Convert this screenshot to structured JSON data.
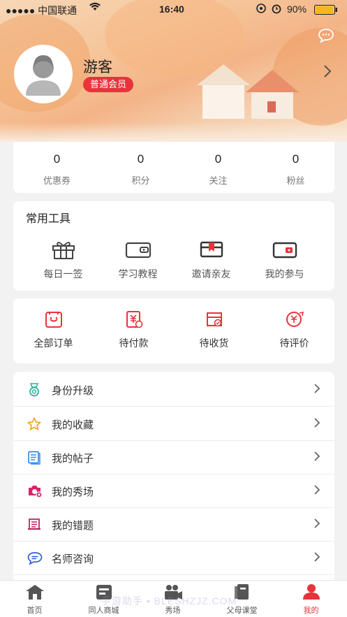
{
  "status_bar": {
    "carrier": "●●●●● 中国联通",
    "time": "16:40",
    "battery": "90%"
  },
  "profile": {
    "username": "游客",
    "membership": "普通会员"
  },
  "stats": [
    {
      "value": "0",
      "label": "优惠券"
    },
    {
      "value": "0",
      "label": "积分"
    },
    {
      "value": "0",
      "label": "关注"
    },
    {
      "value": "0",
      "label": "粉丝"
    }
  ],
  "tools": {
    "title": "常用工具",
    "items": [
      {
        "label": "每日一签",
        "icon": "gift-icon"
      },
      {
        "label": "学习教程",
        "icon": "wallet-icon"
      },
      {
        "label": "邀请亲友",
        "icon": "box-icon"
      },
      {
        "label": "我的参与",
        "icon": "card-icon"
      }
    ]
  },
  "orders": [
    {
      "label": "全部订单",
      "icon": "order-list-icon"
    },
    {
      "label": "待付款",
      "icon": "payment-icon"
    },
    {
      "label": "待收货",
      "icon": "delivery-icon"
    },
    {
      "label": "待评价",
      "icon": "review-icon"
    }
  ],
  "menu": [
    {
      "label": "身份升级",
      "icon": "medal-icon"
    },
    {
      "label": "我的收藏",
      "icon": "star-icon"
    },
    {
      "label": "我的帖子",
      "icon": "document-icon"
    },
    {
      "label": "我的秀场",
      "icon": "camera-icon"
    },
    {
      "label": "我的错题",
      "icon": "book-icon"
    },
    {
      "label": "名师咨询",
      "icon": "chat-icon"
    }
  ],
  "tabbar": [
    {
      "label": "首页",
      "icon": "home-icon"
    },
    {
      "label": "同人商城",
      "icon": "store-icon"
    },
    {
      "label": "秀场",
      "icon": "video-camera-icon"
    },
    {
      "label": "父母课堂",
      "icon": "classroom-icon"
    },
    {
      "label": "我的",
      "icon": "user-icon",
      "active": true
    }
  ],
  "watermark": "手游助手 • BLESHZJZ.COM",
  "colors": {
    "accent": "#e8333b",
    "teal": "#2bb3a0",
    "blue": "#2f8be6",
    "gold": "#f0a020"
  }
}
